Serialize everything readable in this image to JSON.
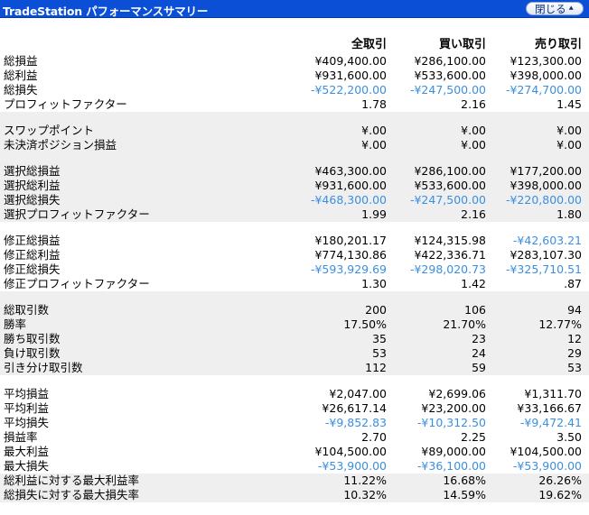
{
  "window": {
    "title": "TradeStation パフォーマンスサマリー",
    "close_label": "閉じる"
  },
  "columns": [
    "全取引",
    "買い取引",
    "売り取引"
  ],
  "groups": [
    {
      "shaded": false,
      "rows": [
        {
          "label": "総損益",
          "values": [
            "¥409,400.00",
            "¥286,100.00",
            "¥123,300.00"
          ],
          "neg": [
            false,
            false,
            false
          ]
        },
        {
          "label": "総利益",
          "values": [
            "¥931,600.00",
            "¥533,600.00",
            "¥398,000.00"
          ],
          "neg": [
            false,
            false,
            false
          ]
        },
        {
          "label": "総損失",
          "values": [
            "-¥522,200.00",
            "-¥247,500.00",
            "-¥274,700.00"
          ],
          "neg": [
            true,
            true,
            true
          ]
        },
        {
          "label": "プロフィットファクター",
          "values": [
            "1.78",
            "2.16",
            "1.45"
          ],
          "neg": [
            false,
            false,
            false
          ]
        }
      ]
    },
    {
      "shaded": true,
      "rows": [
        {
          "label": "スワップポイント",
          "values": [
            "¥.00",
            "¥.00",
            "¥.00"
          ],
          "neg": [
            false,
            false,
            false
          ]
        },
        {
          "label": "未決済ポジション損益",
          "values": [
            "¥.00",
            "¥.00",
            "¥.00"
          ],
          "neg": [
            false,
            false,
            false
          ]
        }
      ]
    },
    {
      "shaded": false,
      "rows": [
        {
          "label": "選択総損益",
          "values": [
            "¥463,300.00",
            "¥286,100.00",
            "¥177,200.00"
          ],
          "neg": [
            false,
            false,
            false
          ]
        },
        {
          "label": "選択総利益",
          "values": [
            "¥931,600.00",
            "¥533,600.00",
            "¥398,000.00"
          ],
          "neg": [
            false,
            false,
            false
          ]
        },
        {
          "label": "選択総損失",
          "values": [
            "-¥468,300.00",
            "-¥247,500.00",
            "-¥220,800.00"
          ],
          "neg": [
            true,
            true,
            true
          ]
        },
        {
          "label": "選択プロフィットファクター",
          "values": [
            "1.99",
            "2.16",
            "1.80"
          ],
          "neg": [
            false,
            false,
            false
          ]
        }
      ]
    },
    {
      "shaded": false,
      "rows": [
        {
          "label": "修正総損益",
          "values": [
            "¥180,201.17",
            "¥124,315.98",
            "-¥42,603.21"
          ],
          "neg": [
            false,
            false,
            true
          ]
        },
        {
          "label": "修正総利益",
          "values": [
            "¥774,130.86",
            "¥422,336.71",
            "¥283,107.30"
          ],
          "neg": [
            false,
            false,
            false
          ]
        },
        {
          "label": "修正総損失",
          "values": [
            "-¥593,929.69",
            "-¥298,020.73",
            "-¥325,710.51"
          ],
          "neg": [
            true,
            true,
            true
          ]
        },
        {
          "label": "修正プロフィットファクター",
          "values": [
            "1.30",
            "1.42",
            ".87"
          ],
          "neg": [
            false,
            false,
            false
          ]
        }
      ]
    },
    {
      "shaded": false,
      "rows": [
        {
          "label": "総取引数",
          "values": [
            "200",
            "106",
            "94"
          ],
          "neg": [
            false,
            false,
            false
          ]
        },
        {
          "label": "勝率",
          "values": [
            "17.50%",
            "21.70%",
            "12.77%"
          ],
          "neg": [
            false,
            false,
            false
          ]
        },
        {
          "label": "勝ち取引数",
          "values": [
            "35",
            "23",
            "12"
          ],
          "neg": [
            false,
            false,
            false
          ]
        },
        {
          "label": "負け取引数",
          "values": [
            "53",
            "24",
            "29"
          ],
          "neg": [
            false,
            false,
            false
          ]
        },
        {
          "label": "引き分け取引数",
          "values": [
            "112",
            "59",
            "53"
          ],
          "neg": [
            false,
            false,
            false
          ]
        }
      ]
    },
    {
      "shaded": false,
      "rows": [
        {
          "label": "平均損益",
          "values": [
            "¥2,047.00",
            "¥2,699.06",
            "¥1,311.70"
          ],
          "neg": [
            false,
            false,
            false
          ]
        },
        {
          "label": "平均利益",
          "values": [
            "¥26,617.14",
            "¥23,200.00",
            "¥33,166.67"
          ],
          "neg": [
            false,
            false,
            false
          ]
        },
        {
          "label": "平均損失",
          "values": [
            "-¥9,852.83",
            "-¥10,312.50",
            "-¥9,472.41"
          ],
          "neg": [
            true,
            true,
            true
          ]
        },
        {
          "label": "損益率",
          "values": [
            "2.70",
            "2.25",
            "3.50"
          ],
          "neg": [
            false,
            false,
            false
          ]
        },
        {
          "label": "最大利益",
          "values": [
            "¥104,500.00",
            "¥89,000.00",
            "¥104,500.00"
          ],
          "neg": [
            false,
            false,
            false
          ]
        },
        {
          "label": "最大損失",
          "values": [
            "-¥53,900.00",
            "-¥36,100.00",
            "-¥53,900.00"
          ],
          "neg": [
            true,
            true,
            true
          ]
        },
        {
          "label": "総利益に対する最大利益率",
          "values": [
            "11.22%",
            "16.68%",
            "26.26%"
          ],
          "neg": [
            false,
            false,
            false
          ]
        },
        {
          "label": "総損失に対する最大損失率",
          "values": [
            "10.32%",
            "14.59%",
            "19.62%"
          ],
          "neg": [
            false,
            false,
            false
          ]
        }
      ]
    }
  ]
}
